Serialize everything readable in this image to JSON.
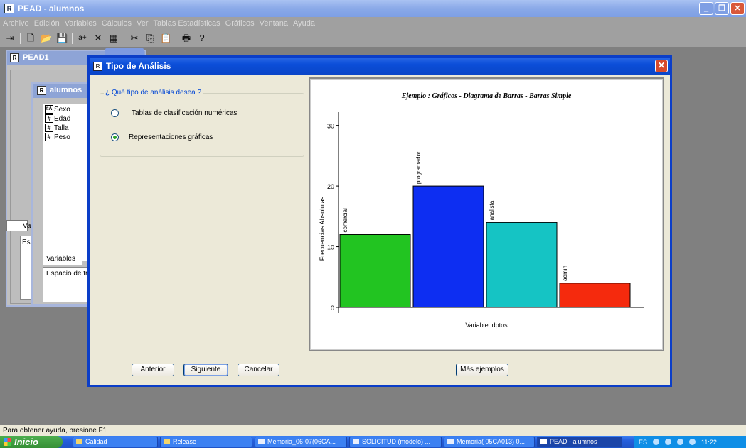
{
  "app": {
    "title": "PEAD - alumnos",
    "icon_label": "R",
    "window_buttons": [
      "minimize",
      "restore",
      "close"
    ]
  },
  "menu": [
    "Archivo",
    "Edición",
    "Variables",
    "Cálculos",
    "Ver",
    "Tablas Estadísticas",
    "Gráficos",
    "Ventana",
    "Ayuda"
  ],
  "toolbar": {
    "icons": [
      "exit-icon",
      "new-file-icon",
      "open-folder-icon",
      "save-icon",
      "rename-variable-icon",
      "delete-icon",
      "table-icon",
      "cut-icon",
      "copy-icon",
      "paste-icon",
      "print-icon",
      "help-icon"
    ]
  },
  "pead1": {
    "title": "PEAD1"
  },
  "alumnos": {
    "title": "alumnos",
    "variables": [
      {
        "name": "Sexo",
        "icon": "#A"
      },
      {
        "name": "Edad",
        "icon": "#"
      },
      {
        "name": "Talla",
        "icon": "#"
      },
      {
        "name": "Peso",
        "icon": "#"
      }
    ],
    "tab_variables": "Variables",
    "workspace_label": "Espacio de trab",
    "side_tab": "Va",
    "side_esp": "Esp"
  },
  "dialog": {
    "title": "Tipo de Análisis",
    "group_legend": "¿ Qué tipo de análisis desea ?",
    "options": [
      {
        "label": "Tablas de clasificación numéricas",
        "checked": false
      },
      {
        "label": "Representaciones gráficas",
        "checked": true
      }
    ],
    "buttons": {
      "back": "Anterior",
      "next": "Siguiente",
      "cancel": "Cancelar",
      "more_examples": "Más ejemplos"
    }
  },
  "chart_data": {
    "type": "bar",
    "title": "Ejemplo : Gráficos - Diagrama de Barras - Barras Simple",
    "xlabel": "Variable: dptos",
    "ylabel": "Frecuencias Absolutas",
    "categories": [
      "comercial",
      "programador",
      "analista",
      "admin"
    ],
    "values": [
      12,
      20,
      14,
      4
    ],
    "colors": [
      "#22c421",
      "#0d2ef2",
      "#15c4c4",
      "#f52a0d"
    ],
    "yticks": [
      0,
      10,
      20,
      30
    ],
    "ylim": [
      0,
      33
    ]
  },
  "status": {
    "text": "Para obtener ayuda, presione F1"
  },
  "taskbar": {
    "start": "Inicio",
    "tasks": [
      {
        "label": "Calidad",
        "icon": "folder-icon",
        "active": false
      },
      {
        "label": "Release",
        "icon": "folder-icon",
        "active": false
      },
      {
        "label": "Memoria_06-07(06CA...",
        "icon": "word-doc-icon",
        "active": false
      },
      {
        "label": "SOLICITUD (modelo) ...",
        "icon": "word-doc-icon",
        "active": false
      },
      {
        "label": "Memoria( 05CA013) 0...",
        "icon": "word-doc-icon",
        "active": false
      },
      {
        "label": "PEAD - alumnos",
        "icon": "app-icon",
        "active": true
      }
    ],
    "tray_lang": "ES",
    "clock": "11:22"
  }
}
